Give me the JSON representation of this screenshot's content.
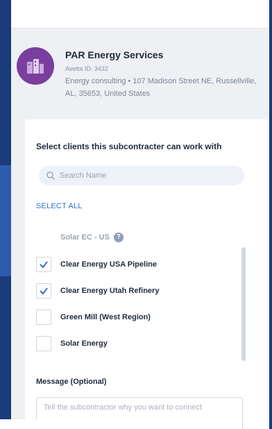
{
  "company": {
    "name": "PAR Energy Services",
    "id_label": "Avetta ID: 3432",
    "description": "Energy consulting • 107 Madison Street NE, Russellville, AL, 35653, United States"
  },
  "panel": {
    "title": "Select clients this subcontracter can work with",
    "search_placeholder": "Search Name",
    "select_all": "SELECT ALL",
    "clients": [
      {
        "label": "Solar EC - US",
        "checked": false,
        "disabled": true
      },
      {
        "label": "Clear Energy USA Pipeline",
        "checked": true,
        "disabled": false
      },
      {
        "label": "Clear Energy Utah Refinery",
        "checked": true,
        "disabled": false
      },
      {
        "label": "Green Mill (West Region)",
        "checked": false,
        "disabled": false
      },
      {
        "label": "Solar Energy",
        "checked": false,
        "disabled": false
      }
    ],
    "message_label": "Message (Optional)",
    "message_placeholder": "Tell the subcontractor why you want to connect"
  },
  "colors": {
    "accent": "#2f6fd1",
    "avatar": "#7a3f9e",
    "backdrop": "#1b3b7a"
  },
  "icons": {
    "search": "search-icon",
    "help": "help-icon",
    "check": "check-icon",
    "avatar": "company-logo-icon"
  }
}
